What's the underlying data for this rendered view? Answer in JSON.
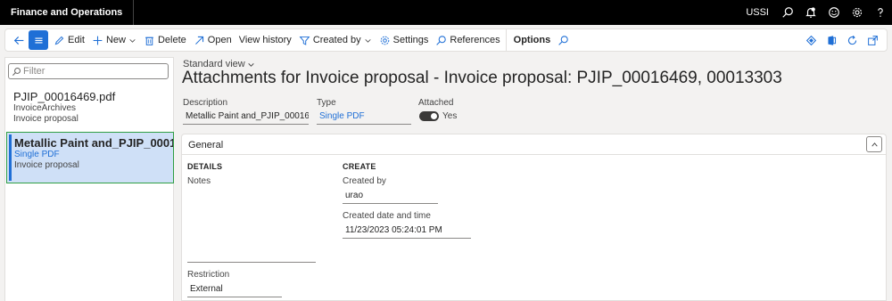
{
  "app": {
    "title": "Finance and Operations",
    "company": "USSI"
  },
  "actions": {
    "edit": "Edit",
    "new": "New",
    "delete": "Delete",
    "open": "Open",
    "view_history": "View history",
    "created_by": "Created by",
    "settings": "Settings",
    "references": "References",
    "options": "Options"
  },
  "list": {
    "filter_placeholder": "Filter",
    "items": [
      {
        "title": "PJIP_00016469.pdf",
        "sub1": "InvoiceArchives",
        "sub2": "Invoice proposal"
      },
      {
        "title": "Metallic Paint and_PJIP_0001...",
        "sub1": "Single PDF",
        "sub2": "Invoice proposal"
      }
    ]
  },
  "header": {
    "view": "Standard view",
    "title": "Attachments for Invoice proposal - Invoice proposal: PJIP_00016469, 00013303",
    "description_label": "Description",
    "description_value": "Metallic Paint and_PJIP_00016...",
    "type_label": "Type",
    "type_value": "Single PDF",
    "attached_label": "Attached",
    "attached_value": "Yes"
  },
  "general": {
    "title": "General",
    "details_heading": "DETAILS",
    "notes_label": "Notes",
    "restriction_label": "Restriction",
    "restriction_value": "External",
    "create_heading": "CREATE",
    "created_by_label": "Created by",
    "created_by_value": "urao",
    "created_dt_label": "Created date and time",
    "created_dt_value": "11/23/2023 05:24:01 PM"
  },
  "colors": {
    "accent": "#1f6fd6",
    "selected_bg": "#cfe0f7",
    "selected_border": "#2f9e44"
  }
}
